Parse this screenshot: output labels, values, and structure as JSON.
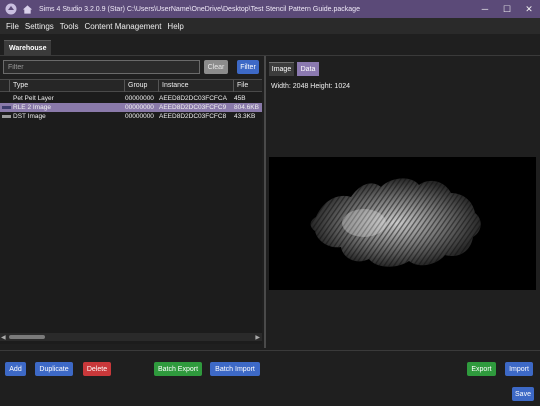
{
  "titlebar": {
    "text": "Sims 4 Studio 3.2.0.9 (Star)  C:\\Users\\UserName\\OneDrive\\Desktop\\Test Stencil Pattern Guide.package",
    "minimize": "─",
    "maximize": "☐",
    "close": "✕"
  },
  "menu": [
    "File",
    "Settings",
    "Tools",
    "Content Management",
    "Help"
  ],
  "tabs": {
    "warehouse": "Warehouse"
  },
  "filter": {
    "placeholder": "Filter",
    "clear": "Clear",
    "filter": "Filter"
  },
  "grid": {
    "columns": [
      "Type",
      "Group",
      "Instance",
      "File"
    ],
    "rows": [
      {
        "type": "Pet Pelt Layer",
        "group": "00000000",
        "instance": "AEED8D2DC03FCFCA",
        "file": "45B",
        "selected": false,
        "icon_color": "#1c1c1c"
      },
      {
        "type": "RLE 2 Image",
        "group": "00000000",
        "instance": "AEED8D2DC03FCFC9",
        "file": "804.6KB",
        "selected": true,
        "icon_color": "#3d3d6e"
      },
      {
        "type": "DST Image",
        "group": "00000000",
        "instance": "AEED8D2DC03FCFC8",
        "file": "43.3KB",
        "selected": false,
        "icon_color": "#9a9a9a"
      }
    ]
  },
  "scroll": {
    "left_arrow": "◀",
    "right_arrow": "▶"
  },
  "preview": {
    "tabs": {
      "image": "Image",
      "data": "Data"
    },
    "dimensions": "Width: 2048 Height: 1024"
  },
  "buttons": {
    "add": "Add",
    "duplicate": "Duplicate",
    "delete": "Delete",
    "batch_export": "Batch Export",
    "batch_import": "Batch Import",
    "export": "Export",
    "import": "Import",
    "save": "Save"
  },
  "colors": {
    "titlebar": "#5b4a78",
    "selected_row": "#8a7aaa",
    "accent_blue": "#3d69c6",
    "delete_red": "#c9383a",
    "green": "#2f9a3d"
  }
}
